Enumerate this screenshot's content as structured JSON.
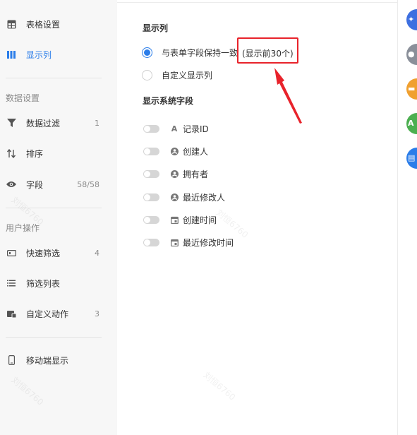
{
  "sidebar": {
    "items_top": [
      {
        "label": "表格设置",
        "icon": "table-grid-icon",
        "active": false
      },
      {
        "label": "显示列",
        "icon": "columns-icon",
        "active": true
      }
    ],
    "section_data": "数据设置",
    "data_items": [
      {
        "label": "数据过滤",
        "icon": "filter-icon",
        "count": "1"
      },
      {
        "label": "排序",
        "icon": "sort-icon",
        "count": ""
      },
      {
        "label": "字段",
        "icon": "eye-icon",
        "count": "58/58"
      }
    ],
    "section_user": "用户操作",
    "user_items": [
      {
        "label": "快速筛选",
        "icon": "quick-filter-icon",
        "count": "4"
      },
      {
        "label": "筛选列表",
        "icon": "list-icon",
        "count": ""
      },
      {
        "label": "自定义动作",
        "icon": "custom-action-icon",
        "count": "3"
      }
    ],
    "mobile_item": {
      "label": "移动端显示",
      "icon": "mobile-icon"
    }
  },
  "main": {
    "display_title": "显示列",
    "option_same": "与表单字段保持一致",
    "option_same_note": "(显示前30个)",
    "option_custom": "自定义显示列",
    "system_title": "显示系统字段",
    "system_fields": [
      {
        "label": "记录ID",
        "icon": "text-a-icon",
        "enabled": false
      },
      {
        "label": "创建人",
        "icon": "user-icon",
        "enabled": false
      },
      {
        "label": "拥有者",
        "icon": "user-icon",
        "enabled": false
      },
      {
        "label": "最近修改人",
        "icon": "user-icon",
        "enabled": false
      },
      {
        "label": "创建时间",
        "icon": "calendar-icon",
        "enabled": false
      },
      {
        "label": "最近修改时间",
        "icon": "calendar-icon",
        "enabled": false
      }
    ]
  },
  "right_strip_colors": [
    "#3d6fe0",
    "#8a8f99",
    "#f0a030",
    "#4caf50",
    "#2b7de9"
  ],
  "accent": "#2b7de9",
  "annotation_color": "#e8232b",
  "watermark": "刘恒6760"
}
